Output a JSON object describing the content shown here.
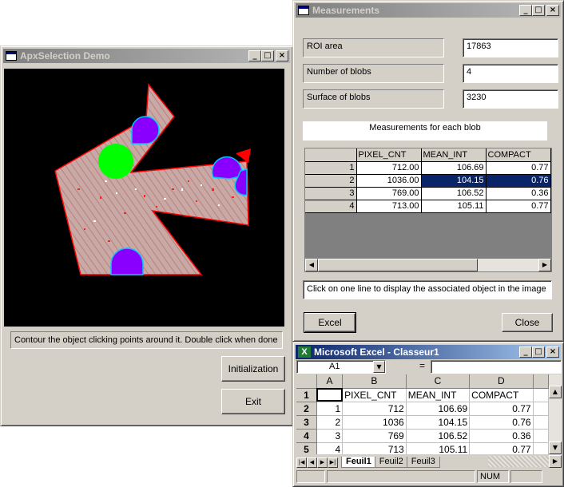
{
  "apx": {
    "title": "ApxSelection Demo",
    "status_text": "Contour the object clicking points around it. Double click when done",
    "init_label": "Initialization",
    "exit_label": "Exit"
  },
  "meas": {
    "title": "Measurements",
    "roi_label": "ROI area",
    "roi_value": "17863",
    "blobs_label": "Number of blobs",
    "blobs_value": "4",
    "surface_label": "Surface of blobs",
    "surface_value": "3230",
    "blob_header": "Measurements for each blob",
    "columns": [
      "PIXEL_CNT",
      "MEAN_INT",
      "COMPACT"
    ],
    "rows": [
      {
        "id": "1",
        "pixel": "712.00",
        "mean": "106.69",
        "compact": "0.77"
      },
      {
        "id": "2",
        "pixel": "1036.00",
        "mean": "104.15",
        "compact": "0.76"
      },
      {
        "id": "3",
        "pixel": "769.00",
        "mean": "106.52",
        "compact": "0.36"
      },
      {
        "id": "4",
        "pixel": "713.00",
        "mean": "105.11",
        "compact": "0.77"
      }
    ],
    "hint": "Click on one line to display the associated object in the image",
    "excel_label": "Excel",
    "close_label": "Close"
  },
  "excel": {
    "title": "Microsoft Excel - Classeur1",
    "cell_ref": "A1",
    "equals": "=",
    "col_headers": [
      "A",
      "B",
      "C",
      "D"
    ],
    "row_numbers": [
      "1",
      "2",
      "3",
      "4",
      "5"
    ],
    "header_row": [
      "",
      "PIXEL_CNT",
      "MEAN_INT",
      "COMPACT"
    ],
    "data_rows": [
      [
        "1",
        "712",
        "106.69",
        "0.77"
      ],
      [
        "2",
        "1036",
        "104.15",
        "0.76"
      ],
      [
        "3",
        "769",
        "106.52",
        "0.36"
      ],
      [
        "4",
        "713",
        "105.11",
        "0.77"
      ]
    ],
    "sheet_tabs": [
      "Feuil1",
      "Feuil2",
      "Feuil3"
    ],
    "status_num": "NUM"
  },
  "colors": {
    "shape_fill": "#c9a9a6",
    "shape_edge": "#ff0000",
    "blob_green": "#00ff00",
    "blob_purple": "#8a00ff",
    "blob_outline": "#00c8ff",
    "selection": "#0a246a"
  },
  "icons": {
    "minimize": "_",
    "maximize": "□",
    "close": "×",
    "arrow_left": "◀",
    "arrow_right": "▶",
    "arrow_down": "▼",
    "first": "|◀",
    "last": "▶|"
  }
}
